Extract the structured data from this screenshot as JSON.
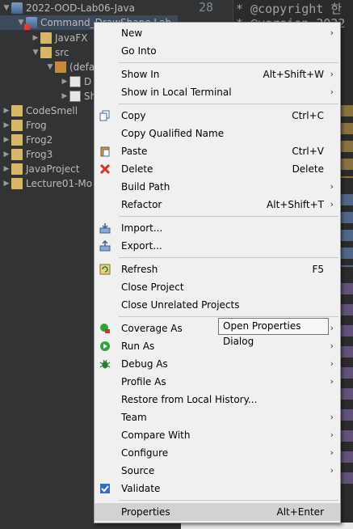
{
  "explorer": {
    "items": [
      {
        "label": "2022-OOD-Lab06-Java",
        "icon": "project-icon"
      },
      {
        "label": "Command_DrawShape Lab",
        "icon": "project-error-icon"
      },
      {
        "label": "JavaFX",
        "icon": "library-icon"
      },
      {
        "label": "src",
        "icon": "source-folder-icon"
      },
      {
        "label": "(defa",
        "icon": "package-icon"
      },
      {
        "label": "D",
        "icon": "java-file-icon"
      },
      {
        "label": "Sh",
        "icon": "java-file-icon"
      },
      {
        "label": "CodeSmell",
        "icon": "project-icon"
      },
      {
        "label": "Frog",
        "icon": "project-icon"
      },
      {
        "label": "Frog2",
        "icon": "project-icon"
      },
      {
        "label": "Frog3",
        "icon": "project-icon"
      },
      {
        "label": "JavaProject",
        "icon": "project-icon"
      },
      {
        "label": "Lecture01-Mo",
        "icon": "project-icon"
      }
    ]
  },
  "editor": {
    "line_number": "28",
    "line_text": "* @copyright 한",
    "line2_text": "* @version 2022"
  },
  "menu": {
    "items": [
      {
        "label": "New",
        "accel": "",
        "submenu": true,
        "icon": ""
      },
      {
        "label": "Go Into",
        "accel": "",
        "submenu": false,
        "icon": ""
      },
      {
        "label": "Show In",
        "accel": "Alt+Shift+W",
        "submenu": true,
        "icon": ""
      },
      {
        "label": "Show in Local Terminal",
        "accel": "",
        "submenu": true,
        "icon": ""
      },
      {
        "label": "Copy",
        "accel": "Ctrl+C",
        "submenu": false,
        "icon": "copy-icon"
      },
      {
        "label": "Copy Qualified Name",
        "accel": "",
        "submenu": false,
        "icon": ""
      },
      {
        "label": "Paste",
        "accel": "Ctrl+V",
        "submenu": false,
        "icon": "paste-icon"
      },
      {
        "label": "Delete",
        "accel": "Delete",
        "submenu": false,
        "icon": "delete-icon"
      },
      {
        "label": "Build Path",
        "accel": "",
        "submenu": true,
        "icon": ""
      },
      {
        "label": "Refactor",
        "accel": "Alt+Shift+T",
        "submenu": true,
        "icon": ""
      },
      {
        "label": "Import...",
        "accel": "",
        "submenu": false,
        "icon": "import-icon"
      },
      {
        "label": "Export...",
        "accel": "",
        "submenu": false,
        "icon": "export-icon"
      },
      {
        "label": "Refresh",
        "accel": "F5",
        "submenu": false,
        "icon": "refresh-icon"
      },
      {
        "label": "Close Project",
        "accel": "",
        "submenu": false,
        "icon": ""
      },
      {
        "label": "Close Unrelated Projects",
        "accel": "",
        "submenu": false,
        "icon": ""
      },
      {
        "label": "Coverage As",
        "accel": "",
        "submenu": true,
        "icon": "coverage-icon"
      },
      {
        "label": "Run As",
        "accel": "",
        "submenu": true,
        "icon": "run-icon"
      },
      {
        "label": "Debug As",
        "accel": "",
        "submenu": true,
        "icon": "debug-icon"
      },
      {
        "label": "Profile As",
        "accel": "",
        "submenu": true,
        "icon": ""
      },
      {
        "label": "Restore from Local History...",
        "accel": "",
        "submenu": false,
        "icon": ""
      },
      {
        "label": "Team",
        "accel": "",
        "submenu": true,
        "icon": ""
      },
      {
        "label": "Compare With",
        "accel": "",
        "submenu": true,
        "icon": ""
      },
      {
        "label": "Configure",
        "accel": "",
        "submenu": true,
        "icon": ""
      },
      {
        "label": "Source",
        "accel": "",
        "submenu": true,
        "icon": ""
      },
      {
        "label": "Validate",
        "accel": "",
        "submenu": false,
        "icon": "validate-icon"
      },
      {
        "label": "Properties",
        "accel": "Alt+Enter",
        "submenu": false,
        "icon": ""
      }
    ],
    "highlighted": "Properties"
  },
  "tooltip": {
    "text": "Open Properties Dialog"
  }
}
